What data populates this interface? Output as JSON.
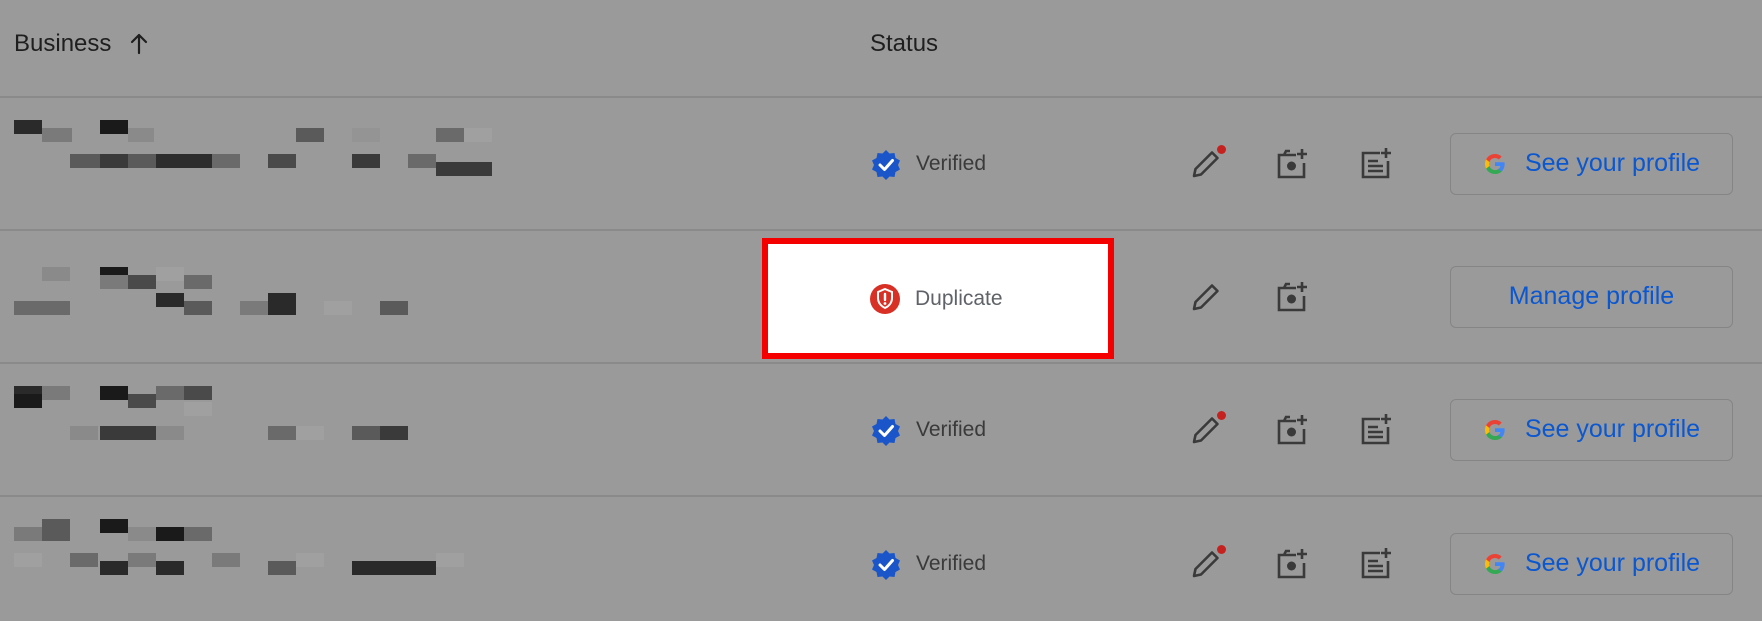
{
  "header": {
    "business_label": "Business",
    "status_label": "Status"
  },
  "rows": [
    {
      "status": "Verified",
      "status_icon": "verified-badge-icon",
      "has_post_action": true,
      "edit_has_alert": true,
      "button_label": "See your profile",
      "button_icon": "google-g-icon"
    },
    {
      "status": "Duplicate",
      "status_icon": "duplicate-shield-icon",
      "has_post_action": false,
      "edit_has_alert": false,
      "button_label": "Manage profile",
      "button_icon": null,
      "highlighted": true
    },
    {
      "status": "Verified",
      "status_icon": "verified-badge-icon",
      "has_post_action": true,
      "edit_has_alert": true,
      "button_label": "See your profile",
      "button_icon": "google-g-icon"
    },
    {
      "status": "Verified",
      "status_icon": "verified-badge-icon",
      "has_post_action": true,
      "edit_has_alert": true,
      "button_label": "See your profile",
      "button_icon": "google-g-icon"
    }
  ],
  "colors": {
    "overlay_background": "#9a9a9a",
    "link_blue": "#0b57d0",
    "verified_blue": "#1a56c9",
    "duplicate_red": "#d93025",
    "highlight_border": "#f40000",
    "alert_dot": "#c5221f"
  }
}
